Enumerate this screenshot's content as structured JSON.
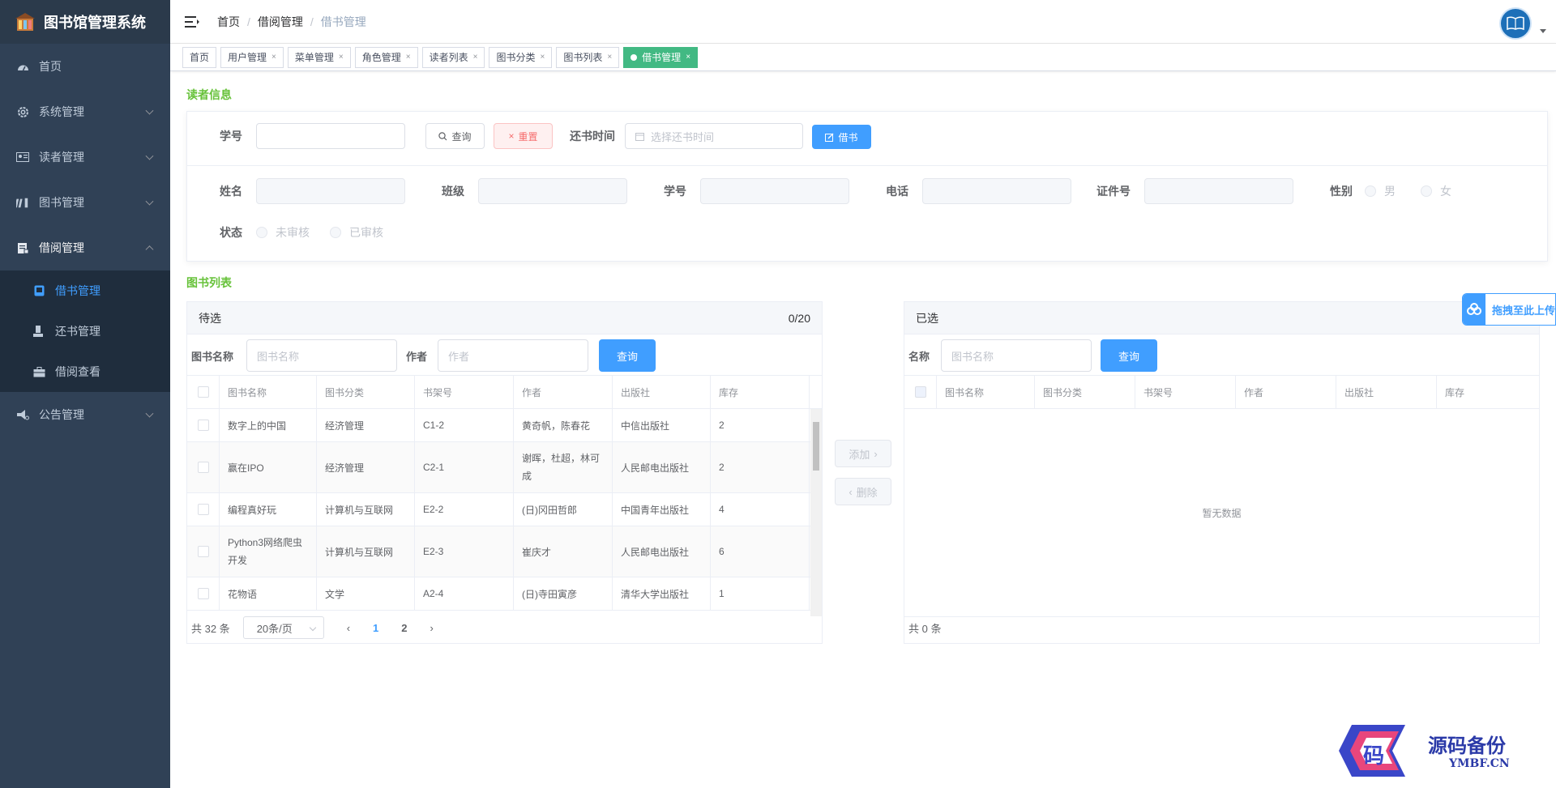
{
  "app": {
    "title": "图书馆管理系统"
  },
  "sidebar": {
    "items": [
      {
        "label": "首页",
        "icon": "dashboard-icon"
      },
      {
        "label": "系统管理",
        "icon": "gear-icon"
      },
      {
        "label": "读者管理",
        "icon": "id-card-icon"
      },
      {
        "label": "图书管理",
        "icon": "books-icon"
      },
      {
        "label": "借阅管理",
        "icon": "document-icon"
      },
      {
        "label": "公告管理",
        "icon": "megaphone-icon"
      }
    ],
    "sub_items": [
      {
        "label": "借书管理",
        "icon": "book-icon"
      },
      {
        "label": "还书管理",
        "icon": "return-icon"
      },
      {
        "label": "借阅查看",
        "icon": "briefcase-icon"
      }
    ]
  },
  "header": {
    "breadcrumb": [
      "首页",
      "借阅管理",
      "借书管理"
    ]
  },
  "tags": [
    {
      "label": "首页"
    },
    {
      "label": "用户管理"
    },
    {
      "label": "菜单管理"
    },
    {
      "label": "角色管理"
    },
    {
      "label": "读者列表"
    },
    {
      "label": "图书分类"
    },
    {
      "label": "图书列表"
    },
    {
      "label": "借书管理"
    }
  ],
  "reader_section": {
    "title": "读者信息",
    "student_no_label": "学号",
    "search_button": "查询",
    "reset_button": "重置",
    "return_time_label": "还书时间",
    "return_time_placeholder": "选择还书时间",
    "borrow_button": "借书",
    "fields": {
      "name": "姓名",
      "class": "班级",
      "student_no": "学号",
      "phone": "电话",
      "id_no": "证件号",
      "gender": "性别",
      "gender_male": "男",
      "gender_female": "女",
      "status": "状态",
      "status_unreviewed": "未审核",
      "status_reviewed": "已审核"
    }
  },
  "book_section": {
    "title": "图书列表",
    "left_panel": {
      "title": "待选",
      "count": "0/20",
      "name_label": "图书名称",
      "name_placeholder": "图书名称",
      "author_label": "作者",
      "author_placeholder": "作者",
      "search_button": "查询",
      "columns": [
        "图书名称",
        "图书分类",
        "书架号",
        "作者",
        "出版社",
        "库存"
      ],
      "rows": [
        {
          "name": "数字上的中国",
          "category": "经济管理",
          "shelf": "C1-2",
          "author": "黄奇帆，陈春花",
          "publisher": "中信出版社",
          "stock": "2"
        },
        {
          "name": "赢在IPO",
          "category": "经济管理",
          "shelf": "C2-1",
          "author": "谢晖，杜超，林可成",
          "publisher": "人民邮电出版社",
          "stock": "2"
        },
        {
          "name": "编程真好玩",
          "category": "计算机与互联网",
          "shelf": "E2-2",
          "author": "(日)冈田哲郎",
          "publisher": "中国青年出版社",
          "stock": "4"
        },
        {
          "name": "Python3网络爬虫开发",
          "category": "计算机与互联网",
          "shelf": "E2-3",
          "author": "崔庆才",
          "publisher": "人民邮电出版社",
          "stock": "6"
        },
        {
          "name": "花物语",
          "category": "文学",
          "shelf": "A2-4",
          "author": "(日)寺田寅彦",
          "publisher": "清华大学出版社",
          "stock": "1"
        }
      ],
      "total": "共 32 条",
      "page_size": "20条/页",
      "pages": [
        "1",
        "2"
      ]
    },
    "add_button": "添加",
    "remove_button": "删除",
    "right_panel": {
      "title": "已选",
      "name_label": "名称",
      "name_placeholder": "图书名称",
      "search_button": "查询",
      "columns": [
        "图书名称",
        "图书分类",
        "书架号",
        "作者",
        "出版社",
        "库存"
      ],
      "empty_text": "暂无数据",
      "total": "共 0 条"
    }
  },
  "float_button": {
    "label": "拖拽至此上传"
  },
  "watermark": {
    "title": "源码备份",
    "url": "YMBF.CN",
    "logo_char": "码"
  },
  "colors": {
    "sidebar": "#304156",
    "accent": "#409eff",
    "tag_active": "#42b983",
    "section_title": "#67c23a"
  }
}
